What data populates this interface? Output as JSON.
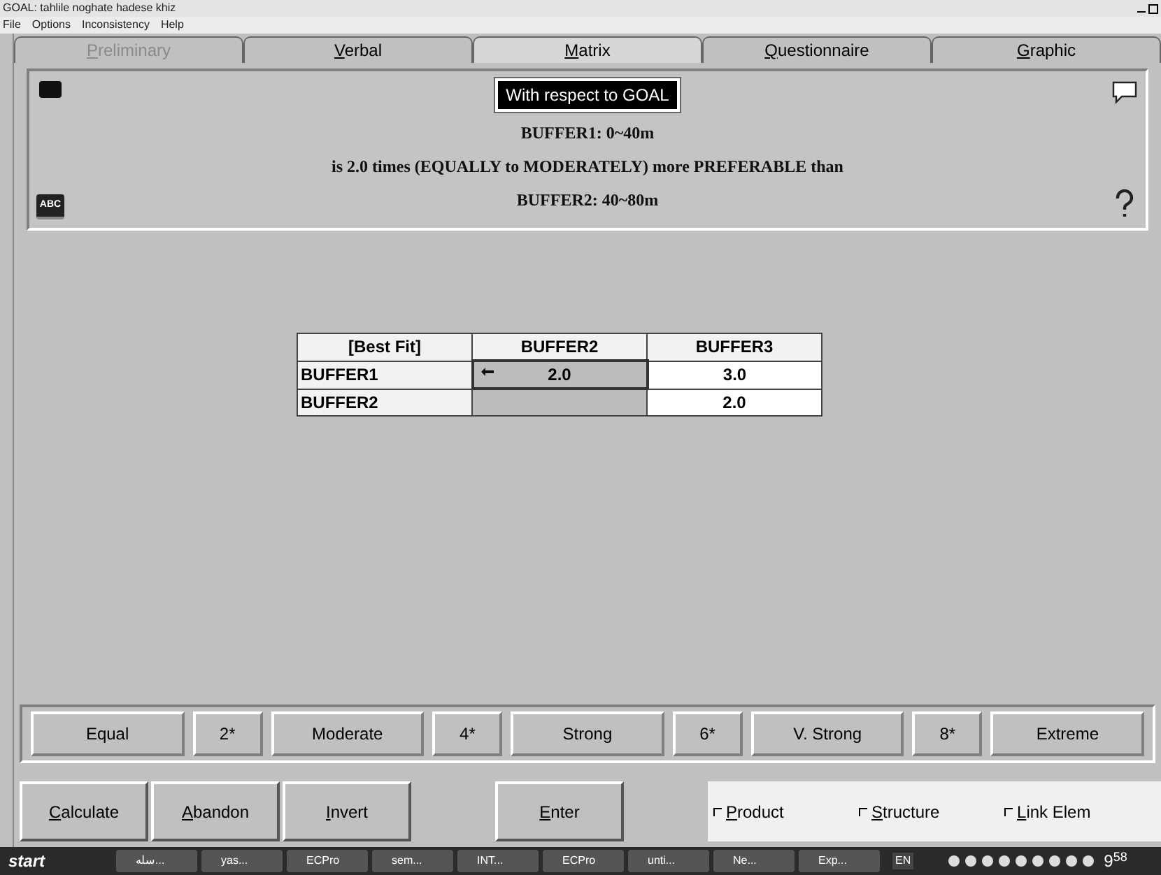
{
  "window": {
    "title": "GOAL: tahlile noghate hadese khiz"
  },
  "menu": [
    "File",
    "Options",
    "Inconsistency",
    "Help"
  ],
  "tabs": [
    {
      "label": "Preliminary",
      "selected": false,
      "disabled": true
    },
    {
      "label": "Verbal",
      "selected": false,
      "disabled": false
    },
    {
      "label": "Matrix",
      "selected": true,
      "disabled": false
    },
    {
      "label": "Questionnaire",
      "selected": false,
      "disabled": false
    },
    {
      "label": "Graphic",
      "selected": false,
      "disabled": false
    }
  ],
  "header": {
    "badge_icon_label": "ABC",
    "context": "With respect to GOAL",
    "lines": [
      "BUFFER1: 0~40m",
      "is 2.0 times (EQUALLY to MODERATELY) more PREFERABLE than",
      "BUFFER2: 40~80m"
    ]
  },
  "table": {
    "corner": "[Best Fit]",
    "columns": [
      "BUFFER2",
      "BUFFER3"
    ],
    "rows": [
      {
        "label": "BUFFER1",
        "cells": [
          {
            "kind": "value",
            "value": "2.0",
            "selected": true
          },
          {
            "kind": "value",
            "value": "3.0",
            "selected": false
          }
        ]
      },
      {
        "label": "BUFFER2",
        "cells": [
          {
            "kind": "blank"
          },
          {
            "kind": "value",
            "value": "2.0",
            "selected": false
          }
        ]
      }
    ]
  },
  "scale": [
    "Equal",
    "2*",
    "Moderate",
    "4*",
    "Strong",
    "6*",
    "V. Strong",
    "8*",
    "Extreme"
  ],
  "actions": [
    "Calculate",
    "Abandon",
    "Invert",
    "Enter"
  ],
  "options": [
    {
      "label": "Product",
      "checked": false
    },
    {
      "label": "Structure",
      "checked": false
    },
    {
      "label": "Link Elem",
      "checked": false
    }
  ],
  "taskbar": {
    "start": "start",
    "tasks": [
      "سله...",
      "yas...",
      "ECPro",
      "sem...",
      "INT...",
      "ECPro",
      "unti...",
      "Ne...",
      "Exp..."
    ],
    "language": "EN",
    "clock": "9$^{58}$"
  }
}
